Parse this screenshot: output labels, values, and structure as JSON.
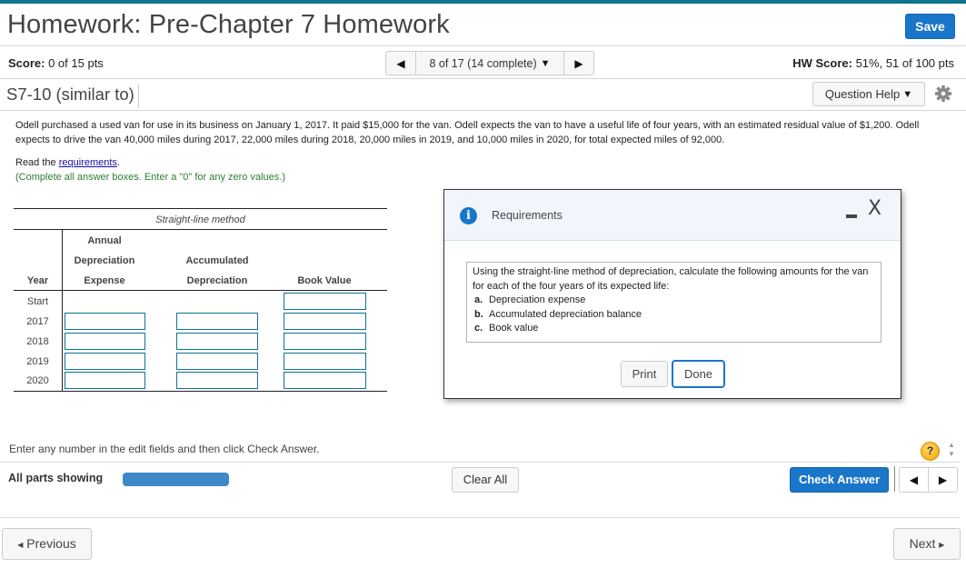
{
  "header": {
    "title": "Homework: Pre-Chapter 7 Homework",
    "save_label": "Save",
    "score_label": "Score:",
    "score_value": "0 of 15 pts",
    "question_nav": {
      "prev_icon": "◀",
      "label": "8 of 17 (14 complete)",
      "dropdown_icon": "▼",
      "next_icon": "▶"
    },
    "hw_score_label": "HW Score:",
    "hw_score_value": "51%, 51 of 100 pts",
    "question_id": "S7-10 (similar to)",
    "question_help_label": "Question Help",
    "question_help_icon": "▼"
  },
  "question": {
    "prompt": "Odell purchased a used van for use in its business on January 1, 2017. It paid $15,000 for the van. Odell expects the van to have a useful life of four years, with an estimated residual value of $1,200. Odell expects to drive the van 40,000 miles during 2017, 22,000 miles during 2018, 20,000 miles in 2019, and 10,000 miles in 2020, for total expected miles of 92,000.",
    "read_prefix": "Read the ",
    "read_link": "requirements",
    "read_suffix": ".",
    "instruction": "(Complete all answer boxes. Enter a \"0\" for any zero values.)"
  },
  "table": {
    "caption": "Straight-line method",
    "headers": {
      "year": "Year",
      "annual_1": "Annual",
      "annual_2": "Depreciation",
      "annual_3": "Expense",
      "accum_1": "Accumulated",
      "accum_2": "Depreciation",
      "book": "Book Value"
    },
    "rows": [
      {
        "year": "Start",
        "expense": "",
        "accumulated": "",
        "book_value": ""
      },
      {
        "year": "2017",
        "expense": "",
        "accumulated": "",
        "book_value": ""
      },
      {
        "year": "2018",
        "expense": "",
        "accumulated": "",
        "book_value": ""
      },
      {
        "year": "2019",
        "expense": "",
        "accumulated": "",
        "book_value": ""
      },
      {
        "year": "2020",
        "expense": "",
        "accumulated": "",
        "book_value": ""
      }
    ]
  },
  "dialog": {
    "title": "Requirements",
    "info_icon": "i",
    "minimize_icon": "minimize",
    "close_icon": "X",
    "intro": "Using the straight-line method of depreciation, calculate the following amounts for the van for each of the four years of its expected life:",
    "items": [
      {
        "letter": "a.",
        "text": "Depreciation expense"
      },
      {
        "letter": "b.",
        "text": "Accumulated depreciation balance"
      },
      {
        "letter": "c.",
        "text": "Book value"
      }
    ],
    "print_label": "Print",
    "done_label": "Done"
  },
  "footer": {
    "enter_hint": "Enter any number in the edit fields and then click Check Answer.",
    "help_icon": "?",
    "all_parts_label": "All parts showing",
    "progress_fraction": 1.0,
    "clear_all_label": "Clear All",
    "check_answer_label": "Check Answer",
    "part_prev_icon": "◀",
    "part_next_icon": "▶",
    "previous_label": "Previous",
    "next_label": "Next"
  },
  "colors": {
    "accent_blue": "#1976c9",
    "top_bar_teal": "#0e7490",
    "input_border": "#0e7490",
    "instruction_green": "#2e7d32",
    "progress_blue": "#4089c9"
  }
}
